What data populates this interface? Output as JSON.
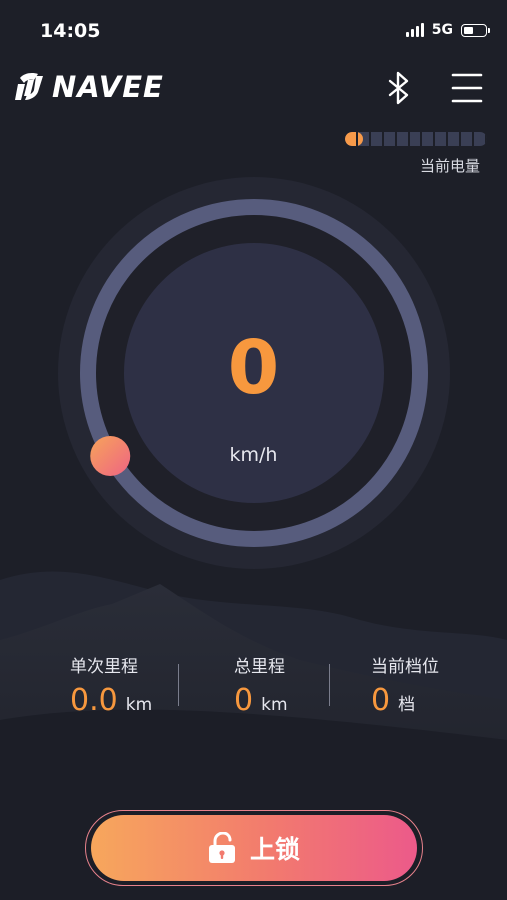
{
  "status_bar": {
    "time": "14:05",
    "network": "5G"
  },
  "header": {
    "logo_text": "NAVEE"
  },
  "battery": {
    "label": "当前电量",
    "level": 0.13
  },
  "gauge": {
    "speed": "0",
    "unit": "km/h",
    "speed_fraction": 0
  },
  "stats": [
    {
      "label": "单次里程",
      "value": "0.0",
      "unit": "km"
    },
    {
      "label": "总里程",
      "value": "0",
      "unit": "km"
    },
    {
      "label": "当前档位",
      "value": "0",
      "unit": "档"
    }
  ],
  "lock_button": {
    "label": "上锁"
  },
  "colors": {
    "accent": "#f7983e",
    "background": "#1d1f28",
    "dial_track": "#575c7d",
    "dial_face": "#2e3045"
  }
}
